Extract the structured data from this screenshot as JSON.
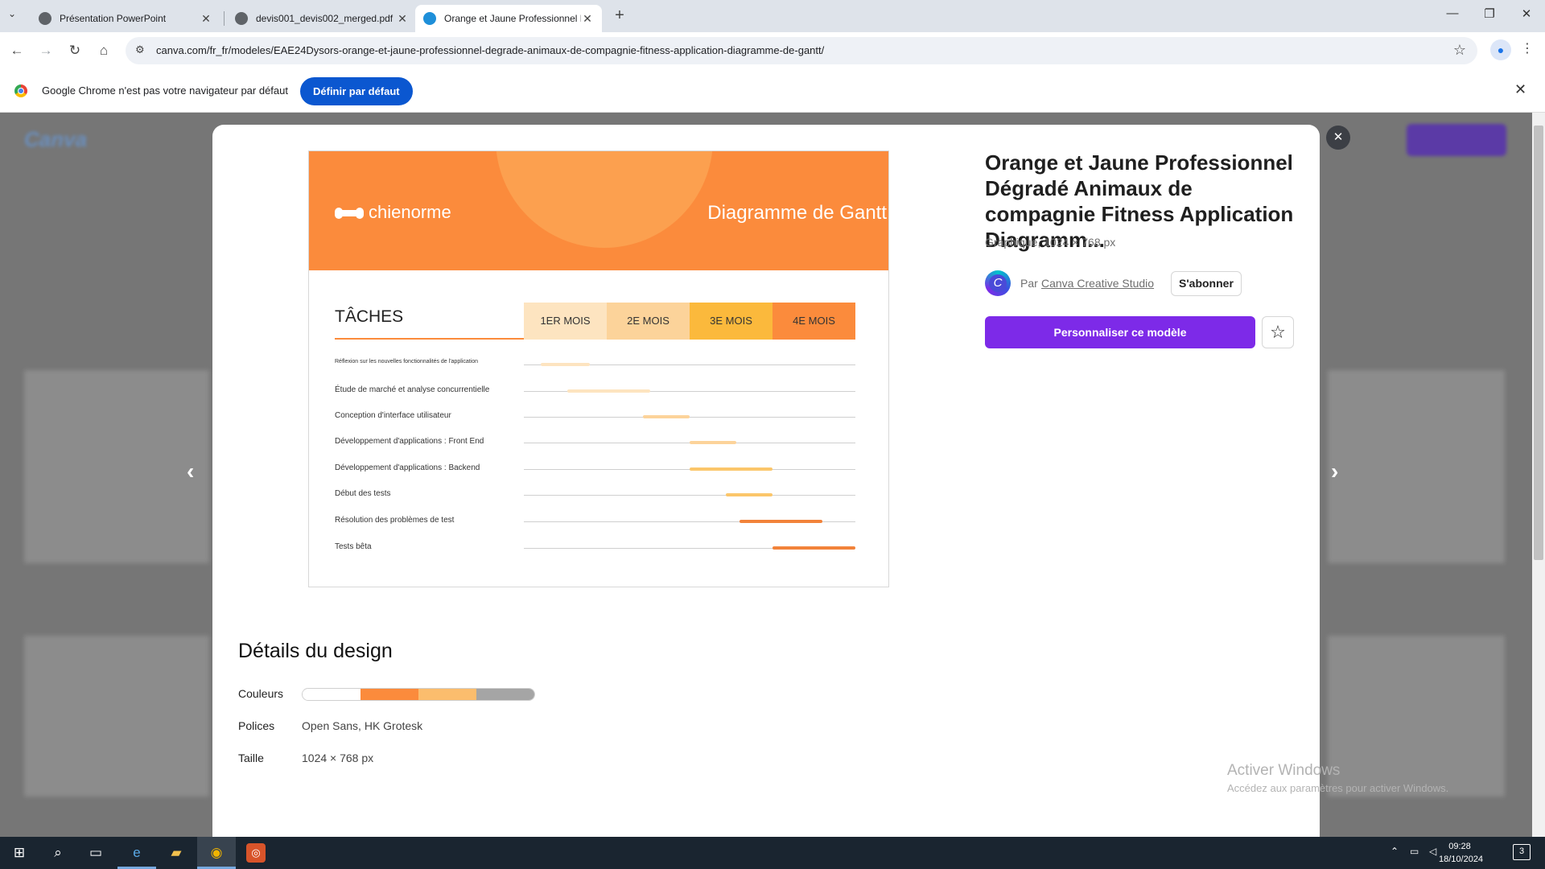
{
  "browser": {
    "tabs": [
      {
        "title": "Présentation PowerPoint"
      },
      {
        "title": "devis001_devis002_merged.pdf"
      },
      {
        "title": "Orange et Jaune Professionnel D"
      }
    ],
    "url": "canva.com/fr_fr/modeles/EAE24Dysors-orange-et-jaune-professionnel-degrade-animaux-de-compagnie-fitness-application-diagramme-de-gantt/"
  },
  "infobar": {
    "message": "Google Chrome n'est pas votre navigateur par défaut",
    "button": "Définir par défaut"
  },
  "template": {
    "title": "Orange et Jaune Professionnel Dégradé Animaux de compagnie Fitness Application Diagramm...",
    "meta": "Graphique, 1024 × 768 px",
    "by_prefix": "Par",
    "creator": "Canva Creative Studio",
    "subscribe": "S'abonner",
    "cta": "Personnaliser ce modèle"
  },
  "preview": {
    "brand": "chienorme",
    "title": "Diagramme de Gantt",
    "tasks_heading": "TÂCHES",
    "months": [
      "1ER MOIS",
      "2E MOIS",
      "3E MOIS",
      "4E MOIS"
    ],
    "month_colors": [
      "#fde4c0",
      "#fcd39a",
      "#fbb93c",
      "#fb8b3c"
    ],
    "tasks": [
      {
        "label": "Réflexion sur les nouvelles fonctionnalités de l'application",
        "start": 0.05,
        "end": 0.2,
        "color": "#fde4c0"
      },
      {
        "label": "Étude de marché et analyse concurrentielle",
        "start": 0.13,
        "end": 0.38,
        "color": "#fde4c0"
      },
      {
        "label": "Conception d'interface utilisateur",
        "start": 0.36,
        "end": 0.5,
        "color": "#fcd39a"
      },
      {
        "label": "Développement d'applications : Front End",
        "start": 0.5,
        "end": 0.64,
        "color": "#fcd39a"
      },
      {
        "label": "Développement d'applications : Backend",
        "start": 0.5,
        "end": 0.75,
        "color": "#fbc66a"
      },
      {
        "label": "Début des tests",
        "start": 0.61,
        "end": 0.75,
        "color": "#fbc66a"
      },
      {
        "label": "Résolution des problèmes de test",
        "start": 0.65,
        "end": 0.9,
        "color": "#f2833a"
      },
      {
        "label": "Tests bêta",
        "start": 0.75,
        "end": 1.0,
        "color": "#f2833a"
      }
    ]
  },
  "details": {
    "heading": "Détails du design",
    "colors_label": "Couleurs",
    "colors": [
      "#ffffff",
      "#fb8b3c",
      "#fbbd6d",
      "#a5a5a5"
    ],
    "fonts_label": "Polices",
    "fonts_value": "Open Sans, HK Grotesk",
    "size_label": "Taille",
    "size_value": "1024 × 768 px"
  },
  "watermark": {
    "line1": "Activer Windows",
    "line2": "Accédez aux paramètres pour activer Windows."
  },
  "taskbar": {
    "time": "09:28",
    "date": "18/10/2024",
    "notifications": "3"
  }
}
